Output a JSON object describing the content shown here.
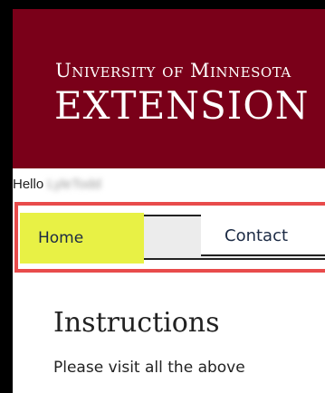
{
  "header": {
    "university": "University of Minnesota",
    "extension": "Extension"
  },
  "greeting": {
    "hello": "Hello",
    "username": "LyleTodd"
  },
  "nav": {
    "tabs": [
      {
        "label": "Home",
        "active": true
      },
      {
        "label": "Contact",
        "active": false
      }
    ],
    "highlight_color": "#e84b4b",
    "active_color": "#e8f145"
  },
  "content": {
    "title": "Instructions",
    "text": "Please visit all the above"
  },
  "colors": {
    "brand": "#7a0019"
  }
}
